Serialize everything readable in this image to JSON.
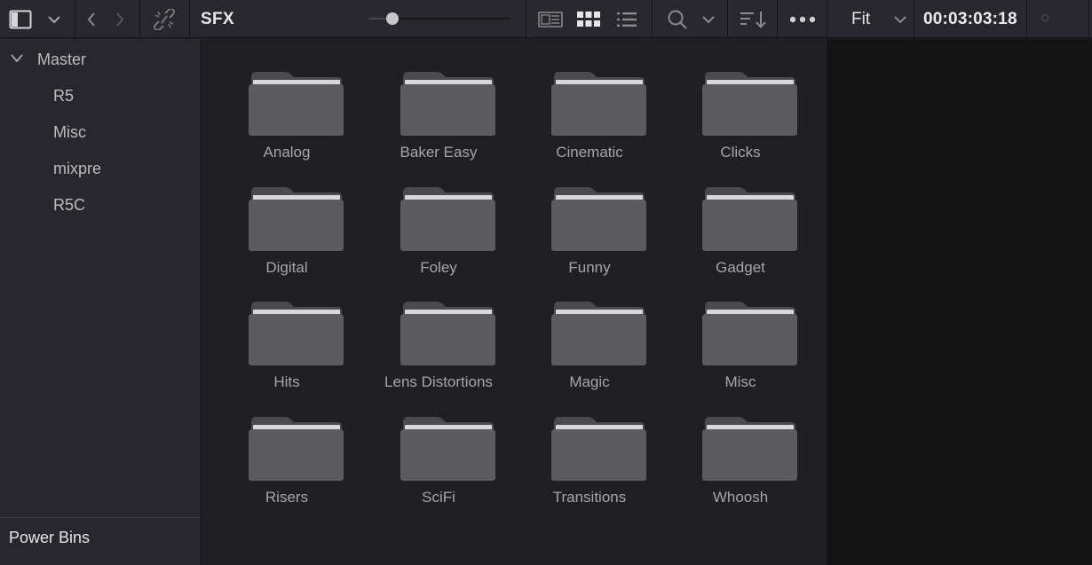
{
  "toolbar": {
    "title": "SFX",
    "zoom_slider_value": 0.17,
    "fit_label": "Fit",
    "timecode": "00:03:03:18",
    "icons": [
      "panel-toggle-icon",
      "chevron-down-icon",
      "back-icon",
      "forward-icon",
      "unlink-icon",
      "thumbnail-view-icon",
      "grid-view-icon",
      "list-view-icon",
      "search-icon",
      "sort-icon",
      "more-options-icon"
    ]
  },
  "sidebar": {
    "root": "Master",
    "items": [
      "R5",
      "Misc",
      "mixpre",
      "R5C"
    ],
    "power_bins": "Power Bins"
  },
  "bins": [
    "Analog",
    "Baker Easy",
    "Cinematic",
    "Clicks",
    "Digital",
    "Foley",
    "Funny",
    "Gadget",
    "Hits",
    "Lens Distortions",
    "Magic",
    "Misc",
    "Risers",
    "SciFi",
    "Transitions",
    "Whoosh"
  ],
  "colors": {
    "toolbar_bg": "#28282e",
    "sidebar_bg": "#27272d",
    "grid_bg": "#1f1f24",
    "viewer_bg": "#141415",
    "folder_body": "#5b5b60",
    "folder_paper": "#d8d8da"
  }
}
